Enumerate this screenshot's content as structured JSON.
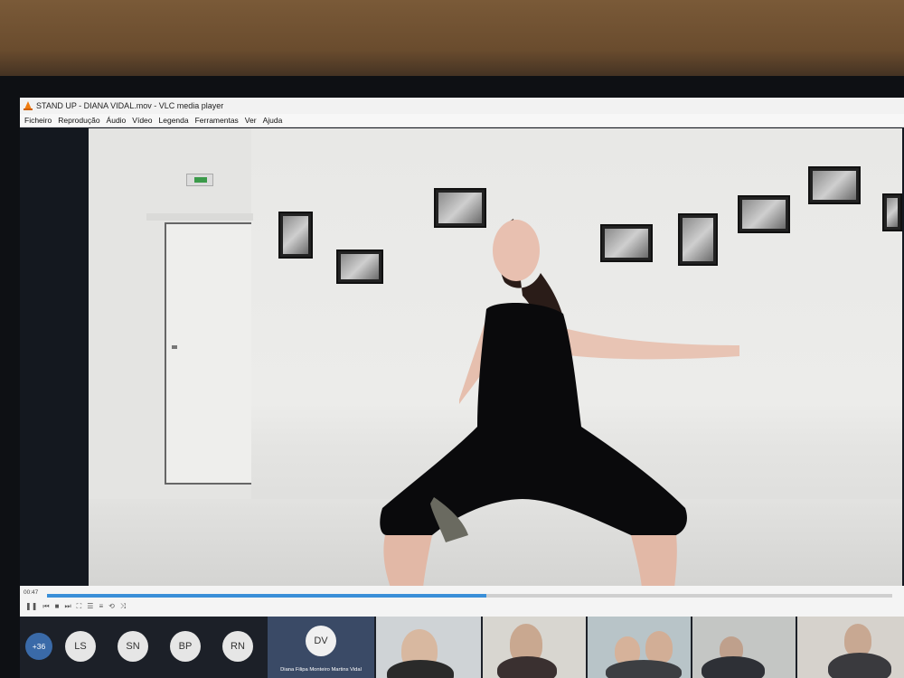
{
  "window": {
    "title": "STAND UP - DIANA VIDAL.mov - VLC media player"
  },
  "menu": {
    "items": [
      "Ficheiro",
      "Reprodução",
      "Áudio",
      "Vídeo",
      "Legenda",
      "Ferramentas",
      "Ver",
      "Ajuda"
    ]
  },
  "player": {
    "elapsed": "00:47",
    "progress": 0.52
  },
  "call": {
    "participant_count": "+36",
    "avatars": [
      "LS",
      "SN",
      "BP",
      "RN"
    ],
    "highlighted": {
      "initials": "DV",
      "name": "Diana Filipa Monteiro Martins Vidal"
    }
  },
  "colors": {
    "accent": "#3a8fd8",
    "vlc_orange": "#f07c10",
    "count_badge": "#3a6aa8",
    "highlight_tile": "#3a4a66"
  }
}
